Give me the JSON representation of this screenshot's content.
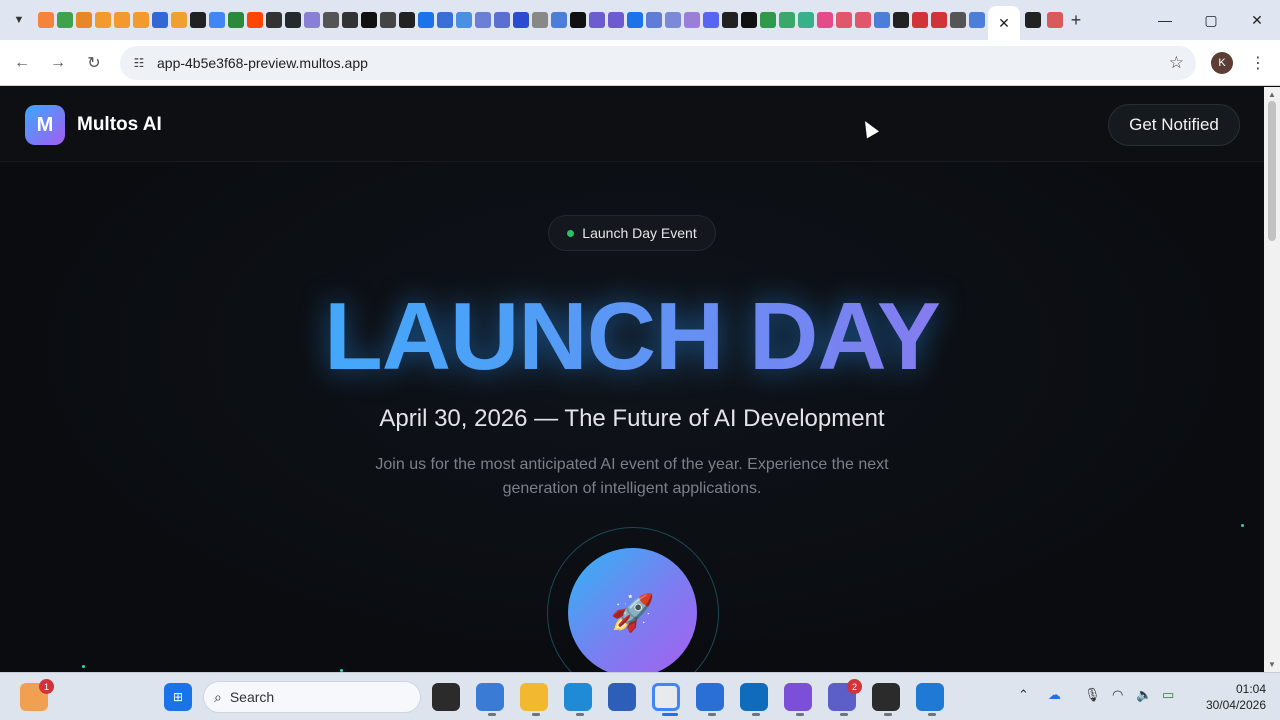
{
  "browser": {
    "active_tab_close": "✕",
    "new_tab": "+",
    "url": "app-4b5e3f68-preview.multos.app",
    "profile_initial": "K",
    "window_controls": {
      "minimize": "—",
      "maximize": "▢",
      "close": "✕"
    }
  },
  "site": {
    "logo_letter": "M",
    "brand": "Multos AI",
    "cta": "Get Notified",
    "badge": "Launch Day Event",
    "headline": "LAUNCH DAY",
    "subtitle": "April 30, 2026 — The Future of AI Development",
    "description": "Join us for the most anticipated AI event of the year. Experience the next generation of intelligent applications.",
    "orb_icon": "🚀"
  },
  "taskbar": {
    "search_placeholder": "Search",
    "weather_badge": "1",
    "teams_badge": "2",
    "time": "01:04",
    "date": "30/04/2026"
  },
  "colors": {
    "accent_blue": "#32b6ff",
    "accent_purple": "#b56ce8",
    "live_dot": "#22c55e"
  }
}
